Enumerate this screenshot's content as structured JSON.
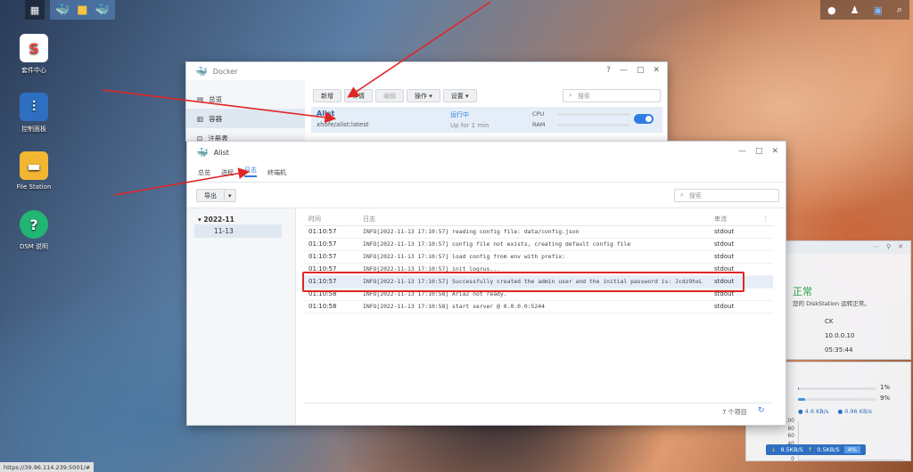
{
  "desktop": {
    "icons": [
      {
        "label": "套件中心"
      },
      {
        "label": "控制面板"
      },
      {
        "label": "File Station"
      },
      {
        "label": "DSM 说明"
      }
    ]
  },
  "docker": {
    "title": "Docker",
    "nav": [
      "总览",
      "容器",
      "注册表"
    ],
    "toolbar": {
      "new": "新增",
      "detail": "详情",
      "edit": "编辑",
      "action": "操作",
      "settings": "设置"
    },
    "search_placeholder": "搜索",
    "container": {
      "name": "Alist",
      "image": "xhofe/alist:latest",
      "status": "运行中",
      "uptime": "Up for 1 min",
      "cpu_label": "CPU",
      "ram_label": "RAM",
      "enabled": true
    }
  },
  "alist": {
    "title": "Alist",
    "tabs": [
      "总览",
      "进程",
      "日志",
      "终端机"
    ],
    "active_tab": "日志",
    "export": "导出",
    "search_placeholder": "搜索",
    "tree": {
      "year": "2022-11",
      "day": "11-13"
    },
    "columns": {
      "time": "时间",
      "log": "日志",
      "stream": "串流"
    },
    "rows": [
      {
        "time": "01:10:57",
        "log": "INFO[2022-11-13 17:10:57] reading config file: data/config.json",
        "stream": "stdout"
      },
      {
        "time": "01:10:57",
        "log": "INFO[2022-11-13 17:10:57] config file not exists, creating default config file",
        "stream": "stdout"
      },
      {
        "time": "01:10:57",
        "log": "INFO[2022-11-13 17:10:57] load config from env with prefix:",
        "stream": "stdout"
      },
      {
        "time": "01:10:57",
        "log": "INFO[2022-11-13 17:10:57] init logrus...",
        "stream": "stdout"
      },
      {
        "time": "01:10:57",
        "log": "INFO[2022-11-13 17:10:57] Successfully created the admin user and the initial password is: Jcdz9hxL",
        "stream": "stdout"
      },
      {
        "time": "01:10:58",
        "log": "INFO[2022-11-13 17:10:58] Aria2 not ready.",
        "stream": "stdout"
      },
      {
        "time": "01:10:58",
        "log": "INFO[2022-11-13 17:10:58] start server @ 0.0.0.0:5244",
        "stream": "stdout"
      }
    ],
    "footer_count": "7 个项目"
  },
  "health_widget": {
    "status": "正常",
    "desc": "您的 DiskStation 运转正常。",
    "values": [
      "CK",
      "10.0.0.10",
      "05:35:44"
    ]
  },
  "resource_widget": {
    "cpu_pct": "1%",
    "ram_pct": "9%",
    "cpu_fill": 1,
    "ram_fill": 9,
    "down": "4.6 KB/s",
    "up": "0.96 KB/s",
    "chart_ticks": [
      "100",
      "80",
      "60",
      "40",
      "20",
      "0"
    ],
    "net_down": "9.5KB/S",
    "net_up": "0.5KB/S",
    "net_pct": "4%"
  },
  "status_url": "https://39.96.114.239:5001/#",
  "colors": {
    "accent": "#2f7de1",
    "highlight": "#e02626",
    "ok_green": "#2aa14a"
  }
}
